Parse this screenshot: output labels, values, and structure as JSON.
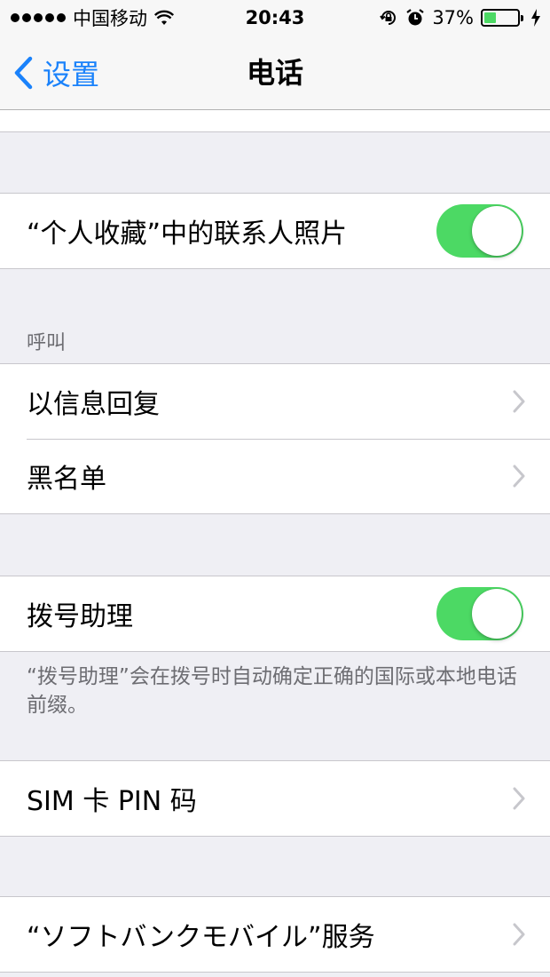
{
  "status_bar": {
    "carrier": "中国移动",
    "time": "20:43",
    "battery_percent_label": "37%",
    "battery_level": 0.37
  },
  "nav": {
    "back_label": "设置",
    "title": "电话"
  },
  "favorites_group": {
    "contact_photos_label": "“个人收藏”中的联系人照片",
    "contact_photos_on": true
  },
  "calls_section": {
    "header": "呼叫",
    "items": [
      {
        "label": "以信息回复"
      },
      {
        "label": "黑名单"
      }
    ]
  },
  "dial_assist_group": {
    "label": "拨号助理",
    "on": true,
    "footer": "“拨号助理”会在拨号时自动确定正确的国际或本地电话前缀。"
  },
  "sim_group": {
    "label": "SIM 卡 PIN 码"
  },
  "carrier_services_group": {
    "label": "“ソフトバンクモバイル”服务"
  },
  "colors": {
    "accent": "#1a82fb",
    "toggle_on": "#4cd964",
    "background": "#efeff4"
  }
}
